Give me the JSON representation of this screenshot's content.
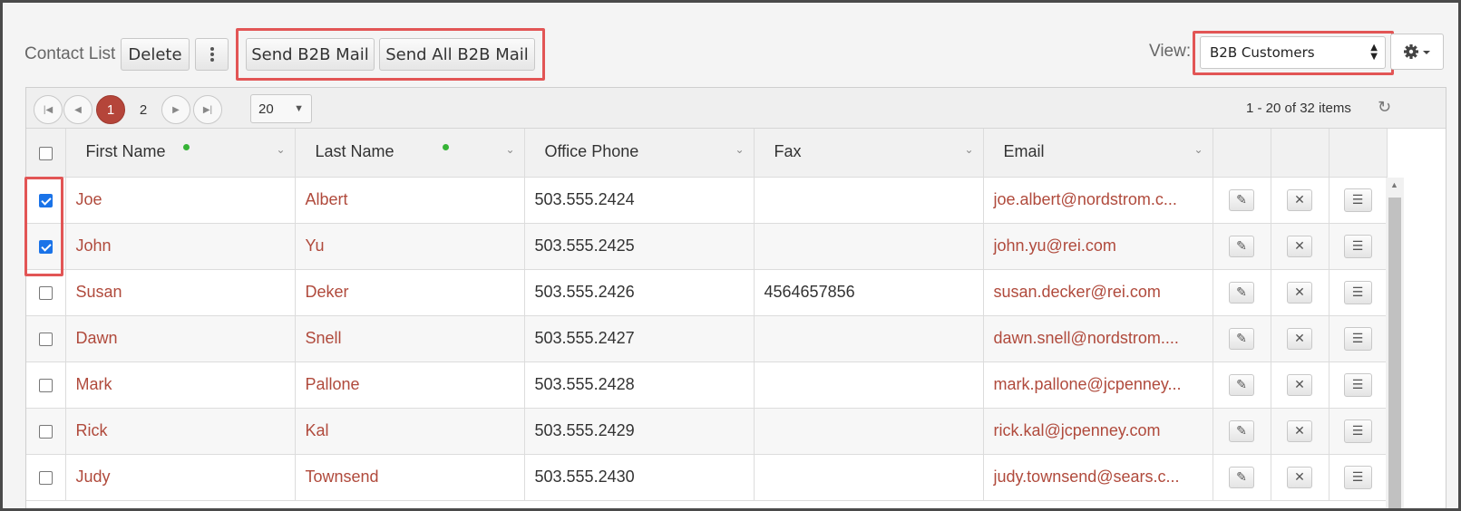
{
  "toolbar": {
    "title": "Contact List",
    "delete_label": "Delete",
    "send_b2b_label": "Send B2B Mail",
    "send_all_b2b_label": "Send All B2B Mail",
    "view_label": "View:",
    "view_selected": "B2B Customers",
    "more_icon": "vertical-dots-icon",
    "settings_icon": "gear-icon"
  },
  "pager": {
    "pages": [
      "1",
      "2"
    ],
    "active_page": "1",
    "page_size": "20",
    "info": "1 - 20 of 32 items"
  },
  "columns": [
    "First Name",
    "Last Name",
    "Office Phone",
    "Fax",
    "Email"
  ],
  "rows": [
    {
      "checked": true,
      "first": "Joe",
      "last": "Albert",
      "phone": "503.555.2424",
      "fax": "",
      "email": "joe.albert@nordstrom.c..."
    },
    {
      "checked": true,
      "first": "John",
      "last": "Yu",
      "phone": "503.555.2425",
      "fax": "",
      "email": "john.yu@rei.com"
    },
    {
      "checked": false,
      "first": "Susan",
      "last": "Deker",
      "phone": "503.555.2426",
      "fax": "4564657856",
      "email": "susan.decker@rei.com"
    },
    {
      "checked": false,
      "first": "Dawn",
      "last": "Snell",
      "phone": "503.555.2427",
      "fax": "",
      "email": "dawn.snell@nordstrom...."
    },
    {
      "checked": false,
      "first": "Mark",
      "last": "Pallone",
      "phone": "503.555.2428",
      "fax": "",
      "email": "mark.pallone@jcpenney..."
    },
    {
      "checked": false,
      "first": "Rick",
      "last": "Kal",
      "phone": "503.555.2429",
      "fax": "",
      "email": "rick.kal@jcpenney.com"
    },
    {
      "checked": false,
      "first": "Judy",
      "last": "Townsend",
      "phone": "503.555.2430",
      "fax": "",
      "email": "judy.townsend@sears.c..."
    }
  ],
  "colors": {
    "link": "#b04a3c",
    "active_page": "#b5453a",
    "highlight": "#e25555",
    "required_dot": "#36b336"
  }
}
